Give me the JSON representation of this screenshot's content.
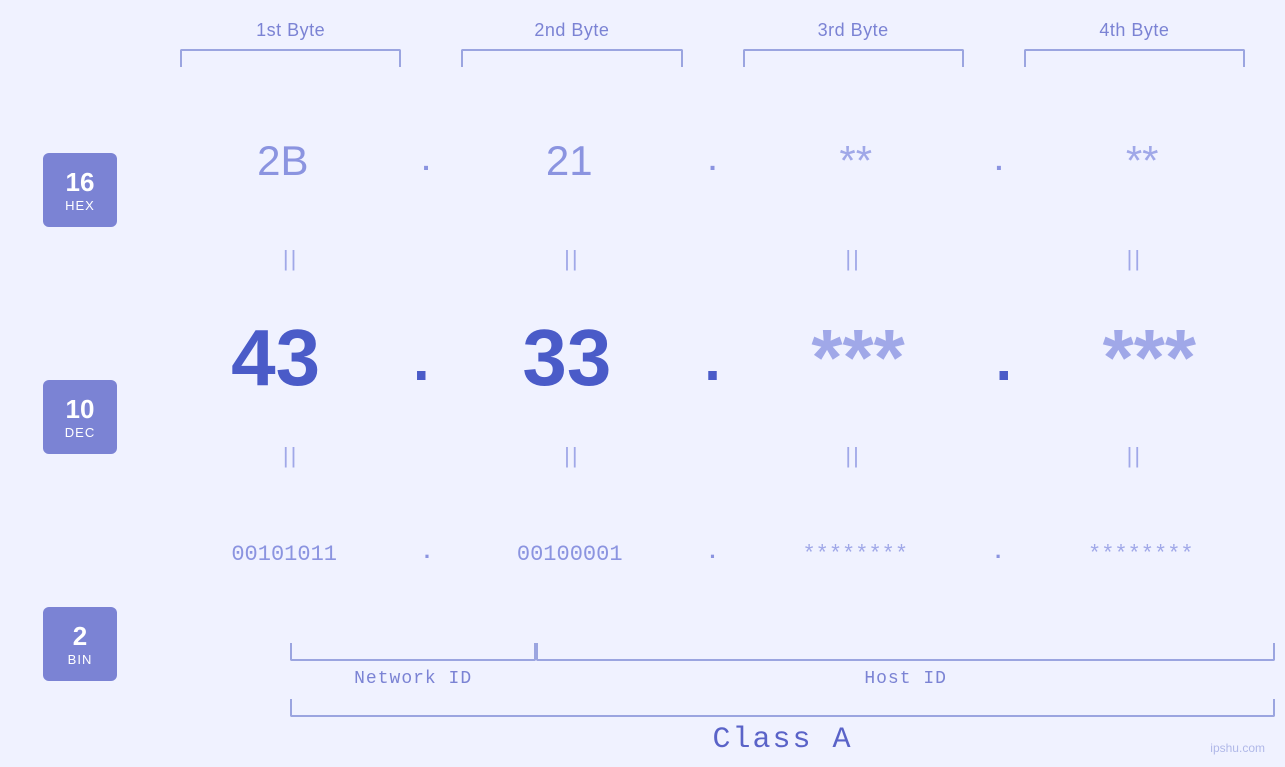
{
  "headers": {
    "byte1": "1st Byte",
    "byte2": "2nd Byte",
    "byte3": "3rd Byte",
    "byte4": "4th Byte"
  },
  "badges": {
    "hex": {
      "number": "16",
      "label": "HEX"
    },
    "dec": {
      "number": "10",
      "label": "DEC"
    },
    "bin": {
      "number": "2",
      "label": "BIN"
    }
  },
  "hex_row": {
    "b1": "2B",
    "b2": "21",
    "b3": "**",
    "b4": "**"
  },
  "dec_row": {
    "b1": "43",
    "b2": "33",
    "b3": "***",
    "b4": "***"
  },
  "bin_row": {
    "b1": "00101011",
    "b2": "00100001",
    "b3": "********",
    "b4": "********"
  },
  "labels": {
    "network_id": "Network ID",
    "host_id": "Host ID",
    "class": "Class A"
  },
  "watermark": "ipshu.com"
}
